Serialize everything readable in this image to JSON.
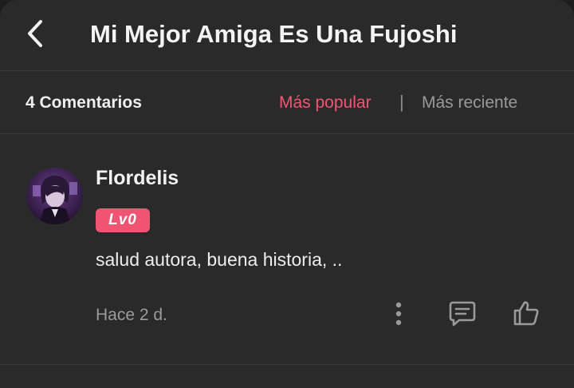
{
  "header": {
    "title": "Mi Mejor Amiga Es Una Fujoshi",
    "back_icon": "chevron-left-icon"
  },
  "sortbar": {
    "count_label": "4 Comentarios",
    "sort_popular": "Más popular",
    "separator": "|",
    "sort_recent": "Más reciente",
    "active_color": "#ec5874"
  },
  "comments": [
    {
      "username": "Flordelis",
      "level": "Lv0",
      "text": "salud autora, buena historia, ..",
      "time": "Hace 2 d.",
      "actions": [
        "more-vertical-icon",
        "comment-icon",
        "thumbs-up-icon"
      ]
    }
  ],
  "colors": {
    "background": "#2a2a2b",
    "accent": "#ef5572"
  }
}
